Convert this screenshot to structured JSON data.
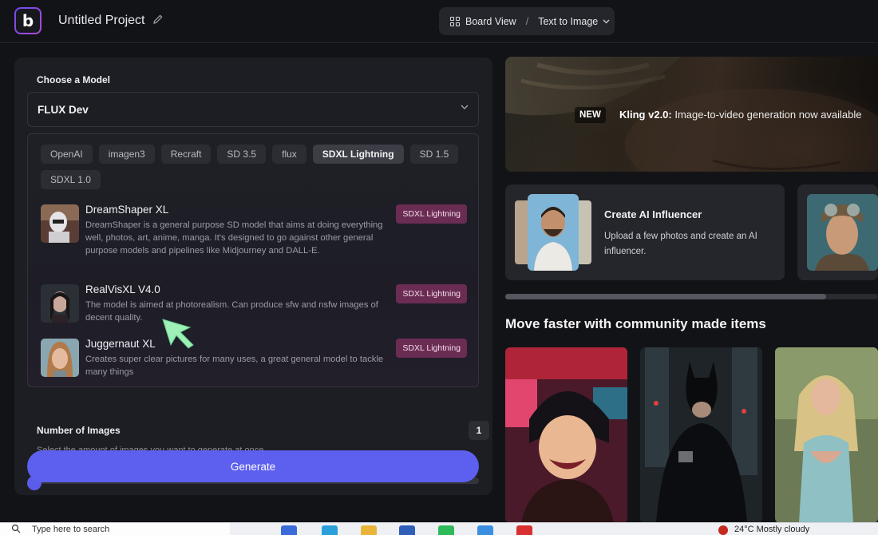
{
  "header": {
    "project_title": "Untitled Project",
    "view_label": "Board View",
    "breadcrumb_sep": "/",
    "mode_label": "Text to Image"
  },
  "model_panel": {
    "section_label": "Choose a Model",
    "selected_model": "FLUX Dev",
    "chips": [
      {
        "label": "OpenAI",
        "active": false
      },
      {
        "label": "imagen3",
        "active": false
      },
      {
        "label": "Recraft",
        "active": false
      },
      {
        "label": "SD 3.5",
        "active": false
      },
      {
        "label": "flux",
        "active": false
      },
      {
        "label": "SDXL Lightning",
        "active": true
      },
      {
        "label": "SD 1.5",
        "active": false
      },
      {
        "label": "SDXL 1.0",
        "active": false
      }
    ],
    "models": [
      {
        "name": "DreamShaper XL",
        "description": "DreamShaper is a general purpose SD model that aims at doing everything well, photos, art, anime, manga. It's designed to go against other general purpose models and pipelines like Midjourney and DALL-E.",
        "badge": "SDXL Lightning"
      },
      {
        "name": "RealVisXL V4.0",
        "description": "The model is aimed at photorealism. Can produce sfw and nsfw images of decent quality.",
        "badge": "SDXL Lightning"
      },
      {
        "name": "Juggernaut XL",
        "description": "Creates super clear pictures for many uses, a great general model to tackle many things",
        "badge": "SDXL Lightning"
      }
    ],
    "num_images_label": "Number of Images",
    "num_images_value": "1",
    "num_images_sub": "Select the amount of images you want to generate at once",
    "generate_label": "Generate"
  },
  "banner": {
    "badge": "NEW",
    "headline": "Kling v2.0:",
    "text": " Image-to-video generation now available"
  },
  "influencer_card": {
    "title": "Create AI Influencer",
    "description": "Upload a few photos and create an AI influencer."
  },
  "community": {
    "heading": "Move faster with community made items"
  },
  "taskbar": {
    "search_placeholder": "Type here to search",
    "tray_text": "24°C  Mostly cloudy"
  }
}
